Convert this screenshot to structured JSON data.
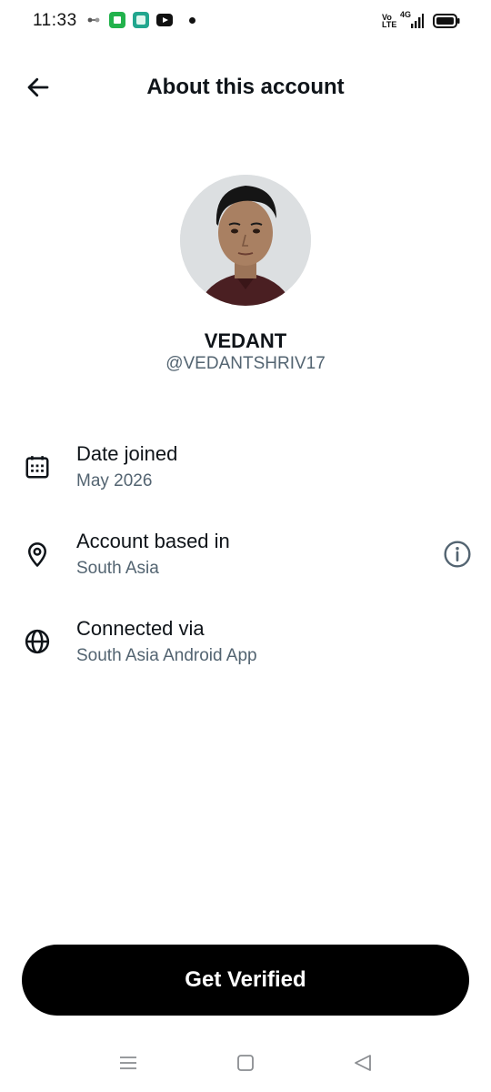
{
  "status_bar": {
    "time": "11:33",
    "network_label": "Vo\nLTE",
    "network_type": "4G",
    "icons": [
      "game-controller-icon",
      "green-app-icon",
      "notes-app-icon",
      "youtube-icon",
      "notification-dot-icon",
      "signal-icon",
      "battery-icon"
    ]
  },
  "header": {
    "title": "About this account",
    "back_icon": "arrow-left-icon"
  },
  "profile": {
    "display_name": "VEDANT",
    "handle": "@VEDANTSHRIV17"
  },
  "details": [
    {
      "icon": "calendar-icon",
      "label": "Date joined",
      "value": "May 2026"
    },
    {
      "icon": "location-pin-icon",
      "label": "Account based in",
      "value": "South Asia",
      "extra_icon": "info-icon"
    },
    {
      "icon": "globe-icon",
      "label": "Connected via",
      "value": "South Asia Android App"
    }
  ],
  "cta": {
    "label": "Get Verified"
  },
  "nav_bar": {
    "items": [
      "menu-icon",
      "home-square-icon",
      "back-triangle-icon"
    ]
  },
  "colors": {
    "text_primary": "#0f1419",
    "text_secondary": "#536471",
    "button_bg": "#000000",
    "button_text": "#ffffff",
    "background": "#ffffff"
  }
}
